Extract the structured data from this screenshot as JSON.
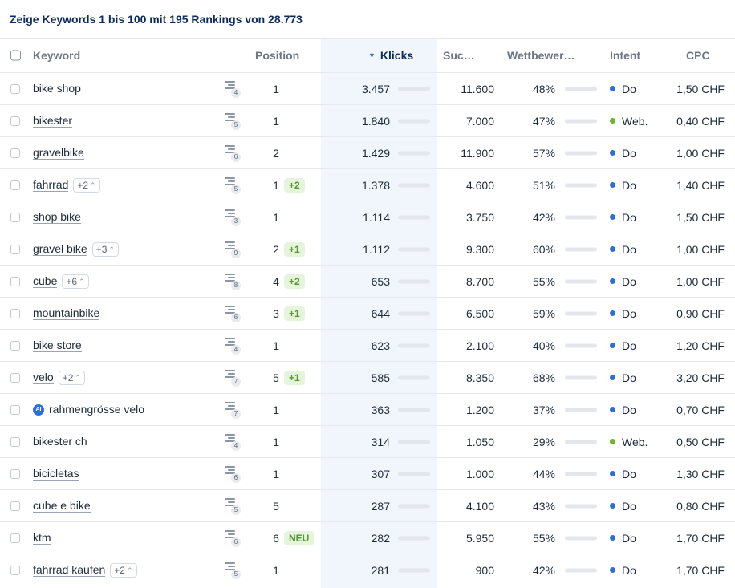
{
  "title": "Zeige Keywords 1 bis 100 mit 195 Rankings von 28.773",
  "columns": {
    "keyword": "Keyword",
    "position": "Position",
    "klicks": "Klicks",
    "suchvolumen": "Suc…",
    "wettbewerb": "Wettbewer…",
    "intent": "Intent",
    "cpc": "CPC"
  },
  "colors": {
    "intent_do": "#2d6fd9",
    "intent_web": "#6cb52d",
    "klicks_bar": "#2d6fd9",
    "competition_bar": "#c8203b",
    "change_badge_bg": "#e6f4dc"
  },
  "rows": [
    {
      "keyword": "bike shop",
      "ai": false,
      "more": "",
      "serp": "4",
      "position": "1",
      "change": "",
      "klicks": "3.457",
      "klicks_fill": 0.62,
      "volume": "11.600",
      "competition": "48%",
      "competition_fill": 0.48,
      "intent": "Do",
      "intent_color": "#2d6fd9",
      "cpc": "1,50 CHF"
    },
    {
      "keyword": "bikester",
      "ai": false,
      "more": "",
      "serp": "5",
      "position": "1",
      "change": "",
      "klicks": "1.840",
      "klicks_fill": 0.52,
      "volume": "7.000",
      "competition": "47%",
      "competition_fill": 0.47,
      "intent": "Web.",
      "intent_color": "#6cb52d",
      "cpc": "0,40 CHF"
    },
    {
      "keyword": "gravelbike",
      "ai": false,
      "more": "",
      "serp": "6",
      "position": "2",
      "change": "",
      "klicks": "1.429",
      "klicks_fill": 0.5,
      "volume": "11.900",
      "competition": "57%",
      "competition_fill": 0.57,
      "intent": "Do",
      "intent_color": "#2d6fd9",
      "cpc": "1,00 CHF"
    },
    {
      "keyword": "fahrrad",
      "ai": false,
      "more": "+2",
      "serp": "5",
      "position": "1",
      "change": "+2",
      "klicks": "1.378",
      "klicks_fill": 0.5,
      "volume": "4.600",
      "competition": "51%",
      "competition_fill": 0.51,
      "intent": "Do",
      "intent_color": "#2d6fd9",
      "cpc": "1,40 CHF"
    },
    {
      "keyword": "shop bike",
      "ai": false,
      "more": "",
      "serp": "3",
      "position": "1",
      "change": "",
      "klicks": "1.114",
      "klicks_fill": 0.48,
      "volume": "3.750",
      "competition": "42%",
      "competition_fill": 0.42,
      "intent": "Do",
      "intent_color": "#2d6fd9",
      "cpc": "1,50 CHF"
    },
    {
      "keyword": "gravel bike",
      "ai": false,
      "more": "+3",
      "serp": "9",
      "position": "2",
      "change": "+1",
      "klicks": "1.112",
      "klicks_fill": 0.48,
      "volume": "9.300",
      "competition": "60%",
      "competition_fill": 0.6,
      "intent": "Do",
      "intent_color": "#2d6fd9",
      "cpc": "1,00 CHF"
    },
    {
      "keyword": "cube",
      "ai": false,
      "more": "+6",
      "serp": "8",
      "position": "4",
      "change": "+2",
      "klicks": "653",
      "klicks_fill": 0.38,
      "volume": "8.700",
      "competition": "55%",
      "competition_fill": 0.55,
      "intent": "Do",
      "intent_color": "#2d6fd9",
      "cpc": "1,00 CHF"
    },
    {
      "keyword": "mountainbike",
      "ai": false,
      "more": "",
      "serp": "6",
      "position": "3",
      "change": "+1",
      "klicks": "644",
      "klicks_fill": 0.38,
      "volume": "6.500",
      "competition": "59%",
      "competition_fill": 0.59,
      "intent": "Do",
      "intent_color": "#2d6fd9",
      "cpc": "0,90 CHF"
    },
    {
      "keyword": "bike store",
      "ai": false,
      "more": "",
      "serp": "4",
      "position": "1",
      "change": "",
      "klicks": "623",
      "klicks_fill": 0.38,
      "volume": "2.100",
      "competition": "40%",
      "competition_fill": 0.4,
      "intent": "Do",
      "intent_color": "#2d6fd9",
      "cpc": "1,20 CHF"
    },
    {
      "keyword": "velo",
      "ai": false,
      "more": "+2",
      "serp": "7",
      "position": "5",
      "change": "+1",
      "klicks": "585",
      "klicks_fill": 0.37,
      "volume": "8.350",
      "competition": "68%",
      "competition_fill": 0.68,
      "intent": "Do",
      "intent_color": "#2d6fd9",
      "cpc": "3,20 CHF"
    },
    {
      "keyword": "rahmengrösse velo",
      "ai": true,
      "ai_label": "AI",
      "more": "",
      "serp": "7",
      "position": "1",
      "change": "",
      "klicks": "363",
      "klicks_fill": 0.33,
      "volume": "1.200",
      "competition": "37%",
      "competition_fill": 0.37,
      "intent": "Do",
      "intent_color": "#2d6fd9",
      "cpc": "0,70 CHF"
    },
    {
      "keyword": "bikester ch",
      "ai": false,
      "more": "",
      "serp": "4",
      "position": "1",
      "change": "",
      "klicks": "314",
      "klicks_fill": 0.32,
      "volume": "1.050",
      "competition": "29%",
      "competition_fill": 0.29,
      "intent": "Web.",
      "intent_color": "#6cb52d",
      "cpc": "0,50 CHF"
    },
    {
      "keyword": "bicicletas",
      "ai": false,
      "more": "",
      "serp": "6",
      "position": "1",
      "change": "",
      "klicks": "307",
      "klicks_fill": 0.32,
      "volume": "1.000",
      "competition": "44%",
      "competition_fill": 0.44,
      "intent": "Do",
      "intent_color": "#2d6fd9",
      "cpc": "1,30 CHF"
    },
    {
      "keyword": "cube e bike",
      "ai": false,
      "more": "",
      "serp": "5",
      "position": "5",
      "change": "",
      "klicks": "287",
      "klicks_fill": 0.31,
      "volume": "4.100",
      "competition": "43%",
      "competition_fill": 0.43,
      "intent": "Do",
      "intent_color": "#2d6fd9",
      "cpc": "0,80 CHF"
    },
    {
      "keyword": "ktm",
      "ai": false,
      "more": "",
      "serp": "6",
      "position": "6",
      "change": "NEU",
      "klicks": "282",
      "klicks_fill": 0.31,
      "volume": "5.950",
      "competition": "55%",
      "competition_fill": 0.55,
      "intent": "Do",
      "intent_color": "#2d6fd9",
      "cpc": "1,70 CHF"
    },
    {
      "keyword": "fahrrad kaufen",
      "ai": false,
      "more": "+2",
      "serp": "5",
      "position": "1",
      "change": "",
      "klicks": "281",
      "klicks_fill": 0.31,
      "volume": "900",
      "competition": "42%",
      "competition_fill": 0.42,
      "intent": "Do",
      "intent_color": "#2d6fd9",
      "cpc": "1,70 CHF"
    }
  ]
}
